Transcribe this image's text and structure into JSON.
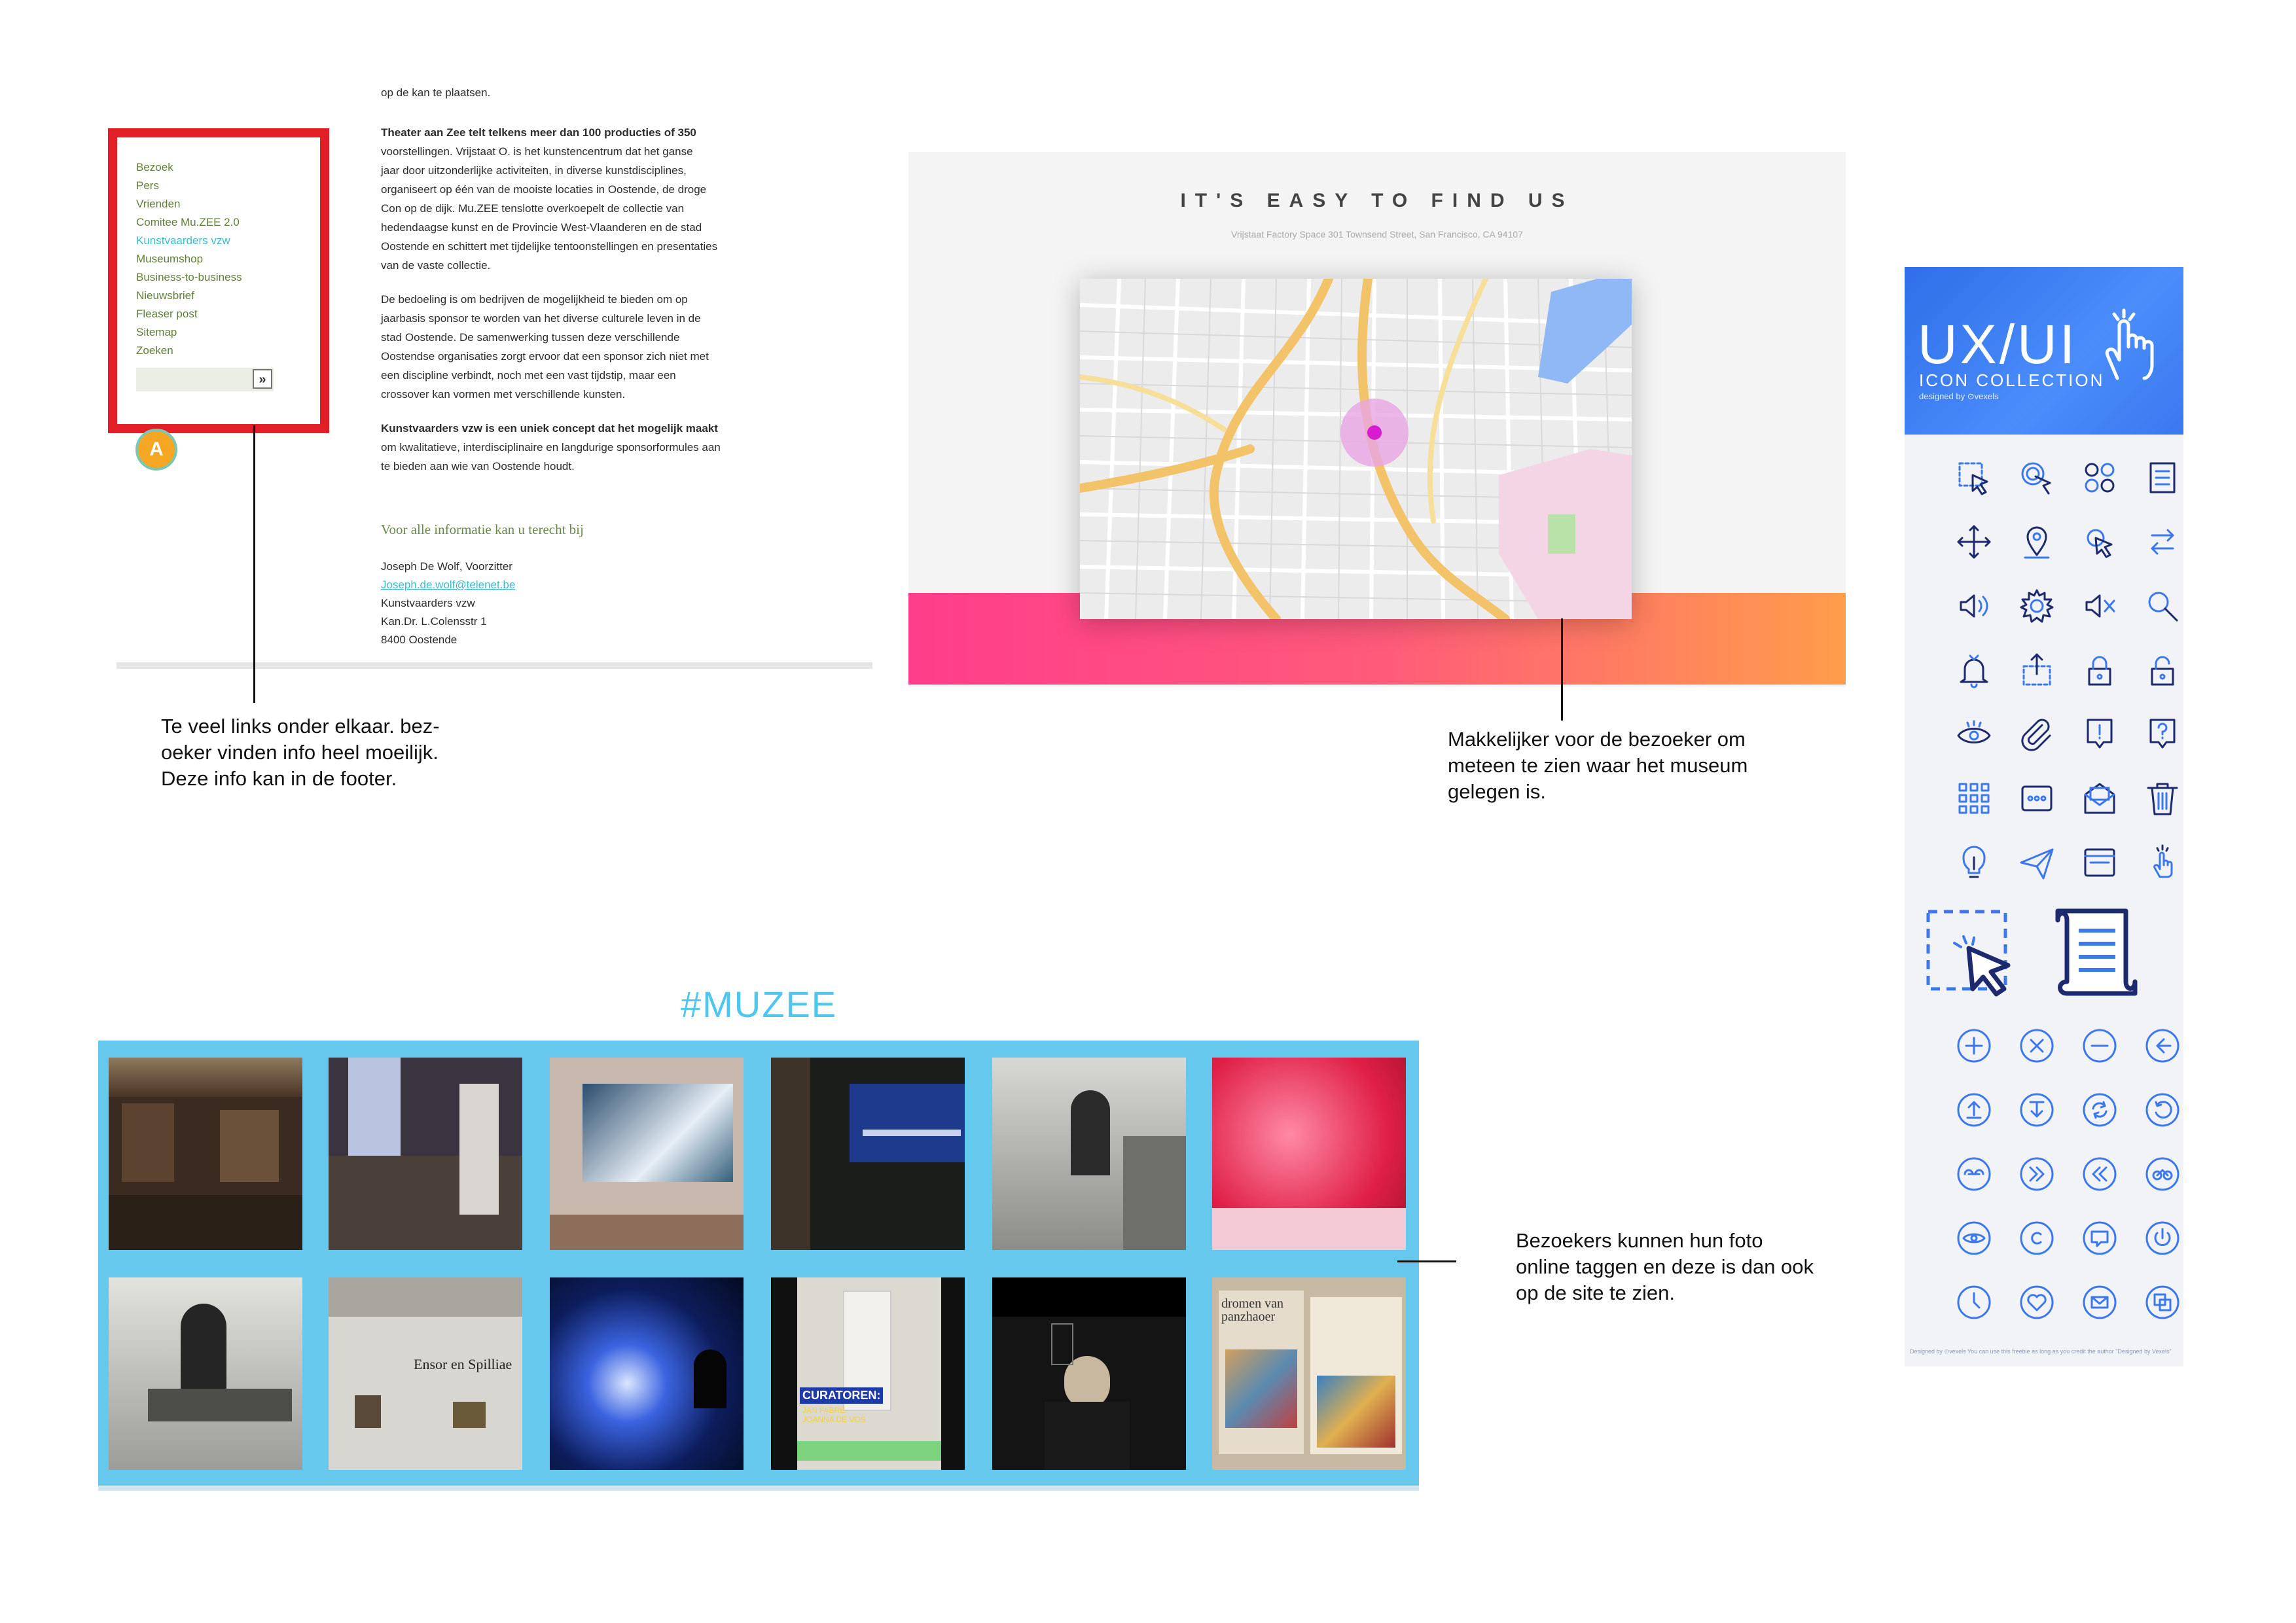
{
  "panel1": {
    "nav_items": [
      "Bezoek",
      "Pers",
      "Vrienden",
      "Comitee Mu.ZEE 2.0",
      "Kunstvaarders vzw",
      "Museumshop",
      "Business-to-business",
      "Nieuwsbrief",
      "Fleaser post",
      "Sitemap",
      "Zoeken"
    ],
    "active_nav_index": 4,
    "search_button": "»",
    "logo_letter": "A",
    "top_fragment": "op de kan te plaatsen.",
    "para1_lines": [
      "Theater aan Zee telt telkens meer dan 100 producties of 350",
      "voorstellingen.  Vrijstaat O. is het kunstencentrum dat het ganse",
      "jaar door uitzonderlijke activiteiten, in diverse kunstdisciplines,",
      "organiseert op één van de mooiste locaties in Oostende, de droge",
      "Con op de dijk. Mu.ZEE tenslotte overkoepelt de collectie van",
      "hedendaagse kunst en de Provincie West-Vlaanderen en de stad",
      "Oostende en schittert met tijdelijke tentoonstellingen en presentaties",
      "van de vaste collectie."
    ],
    "para2_lines": [
      "De bedoeling is om bedrijven de mogelijkheid te bieden om op",
      "jaarbasis sponsor te worden van het diverse culturele leven in de",
      "stad Oostende.  De samenwerking tussen deze verschillende",
      "Oostendse organisaties zorgt ervoor dat een sponsor zich niet met",
      "een discipline verbindt, noch met een vast tijdstip, maar een",
      "crossover kan vormen met verschillende kunsten."
    ],
    "para3_lines": [
      "Kunstvaarders vzw is een uniek concept dat het mogelijk maakt",
      "om kwalitatieve, interdisciplinaire en langdurige sponsorformules aan",
      "te bieden aan wie van Oostende houdt."
    ],
    "contact_heading": "Voor alle informatie kan u terecht bij",
    "contact_lines": [
      "Joseph De Wolf, Voorzitter",
      "Joseph.de.wolf@telenet.be",
      "Kunstvaarders vzw",
      "Kan.Dr. L.Colensstr 1",
      "8400  Oostende"
    ],
    "annotation": "Te veel links onder elkaar. bez-\noeker vinden info heel moeilijk.\nDeze info kan in de footer."
  },
  "panel2": {
    "title": "IT'S EASY TO FIND US",
    "subtitle": "Vrijstaat Factory Space 301 Townsend Street, San Francisco, CA 94107",
    "annotation": "Makkelijker voor de bezoeker om\nmeteen te zien waar het museum\ngelegen is.",
    "colors": {
      "strip_start": "#ff3d8b",
      "strip_end": "#ff9d4a",
      "marker": "#d81bd1"
    }
  },
  "panel3": {
    "title": "UX/UI",
    "subtitle": "ICON COLLECTION",
    "designed_by": "designed by ⊙vexels",
    "footer": "Designed by ⊙vexels     You can use this freebie as long as you credit the author \"Designed by Vexels\"",
    "accent": "#3b78ee",
    "icons": [
      "selection-icon",
      "touch-icon",
      "apps-icon",
      "document-icon",
      "move-icon",
      "location-pin-icon",
      "click-icon",
      "swap-icon",
      "volume-icon",
      "settings-icon",
      "mute-icon",
      "search-icon",
      "bell-icon",
      "upload-icon",
      "lock-icon",
      "unlock-icon",
      "eye-icon",
      "attachment-icon",
      "alert-icon",
      "help-icon",
      "grid-icon",
      "more-icon",
      "mail-icon",
      "trash-icon",
      "lightbulb-icon",
      "send-icon",
      "window-icon",
      "tap-icon",
      "plus-circle-icon",
      "close-circle-icon",
      "minus-circle-icon",
      "back-circle-icon",
      "up-circle-icon",
      "down-circle-icon",
      "refresh-circle-icon",
      "undo-circle-icon",
      "link-circle-icon",
      "forward-circle-icon",
      "rewind-circle-icon",
      "bike-circle-icon",
      "eye-circle-icon",
      "copyright-circle-icon",
      "chat-circle-icon",
      "power-circle-icon",
      "clock-circle-icon",
      "heart-circle-icon",
      "mail-circle-icon",
      "copy-circle-icon"
    ]
  },
  "panel4": {
    "title": "#MUZEE",
    "annotation": "Bezoekers kunnen hun foto\nonline taggen en deze is dan ook\nop de site te zien.",
    "photos": [
      {
        "name": "photo-gallery-hall",
        "bg": "#3b2a1f"
      },
      {
        "name": "photo-seated-visitors",
        "bg": "#3a3440"
      },
      {
        "name": "photo-wave-painting",
        "bg": "#c9b8ae"
      },
      {
        "name": "photo-dark-installation",
        "bg": "#1a1d1a"
      },
      {
        "name": "photo-bw-figure",
        "bg": "#b8b8b4"
      },
      {
        "name": "photo-red-room",
        "bg": "#e02a4f"
      },
      {
        "name": "photo-bw-man-seated",
        "bg": "#c2c2bd"
      },
      {
        "name": "photo-ensor-room",
        "bg": "#d8d6d0"
      },
      {
        "name": "photo-blue-splash",
        "bg": "#0c1d5c"
      },
      {
        "name": "photo-curatoren",
        "bg": "#dcd9d0"
      },
      {
        "name": "photo-video-man",
        "bg": "#141414"
      },
      {
        "name": "photo-dromen-poster",
        "bg": "#c8b9a3"
      }
    ],
    "photo_texts": {
      "ensor": "Ensor en Spilliae",
      "curatoren": "CURATOREN:",
      "curatoren_sub": "JAN FABRE\nJOANNA DE VOS",
      "dromen": "dromen van\npanzhaoer"
    }
  }
}
